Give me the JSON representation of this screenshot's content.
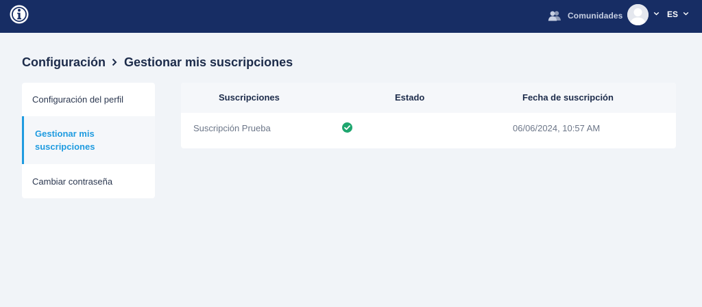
{
  "topbar": {
    "logo_icon": "info-circle-icon",
    "communities_icon": "users-icon",
    "communities_label": "Comunidades",
    "avatar_icon": "user-avatar-icon",
    "language": "ES",
    "background": "#172d64"
  },
  "breadcrumb": {
    "parent": "Configuración",
    "current": "Gestionar mis suscripciones"
  },
  "sidebar": {
    "items": [
      {
        "label": "Configuración del perfil",
        "active": false
      },
      {
        "label": "Gestionar mis suscripciones",
        "active": true
      },
      {
        "label": "Cambiar contraseña",
        "active": false
      }
    ]
  },
  "table": {
    "headers": [
      "Suscripciones",
      "Estado",
      "Fecha de suscripción"
    ],
    "rows": [
      {
        "name": "Suscripción Prueba",
        "status_icon": "check-circle-icon",
        "status": "active",
        "date": "06/06/2024, 10:57 AM"
      }
    ]
  },
  "colors": {
    "accent": "#1e9be0",
    "success": "#1fa66f",
    "page_background": "#f1f4f8"
  }
}
